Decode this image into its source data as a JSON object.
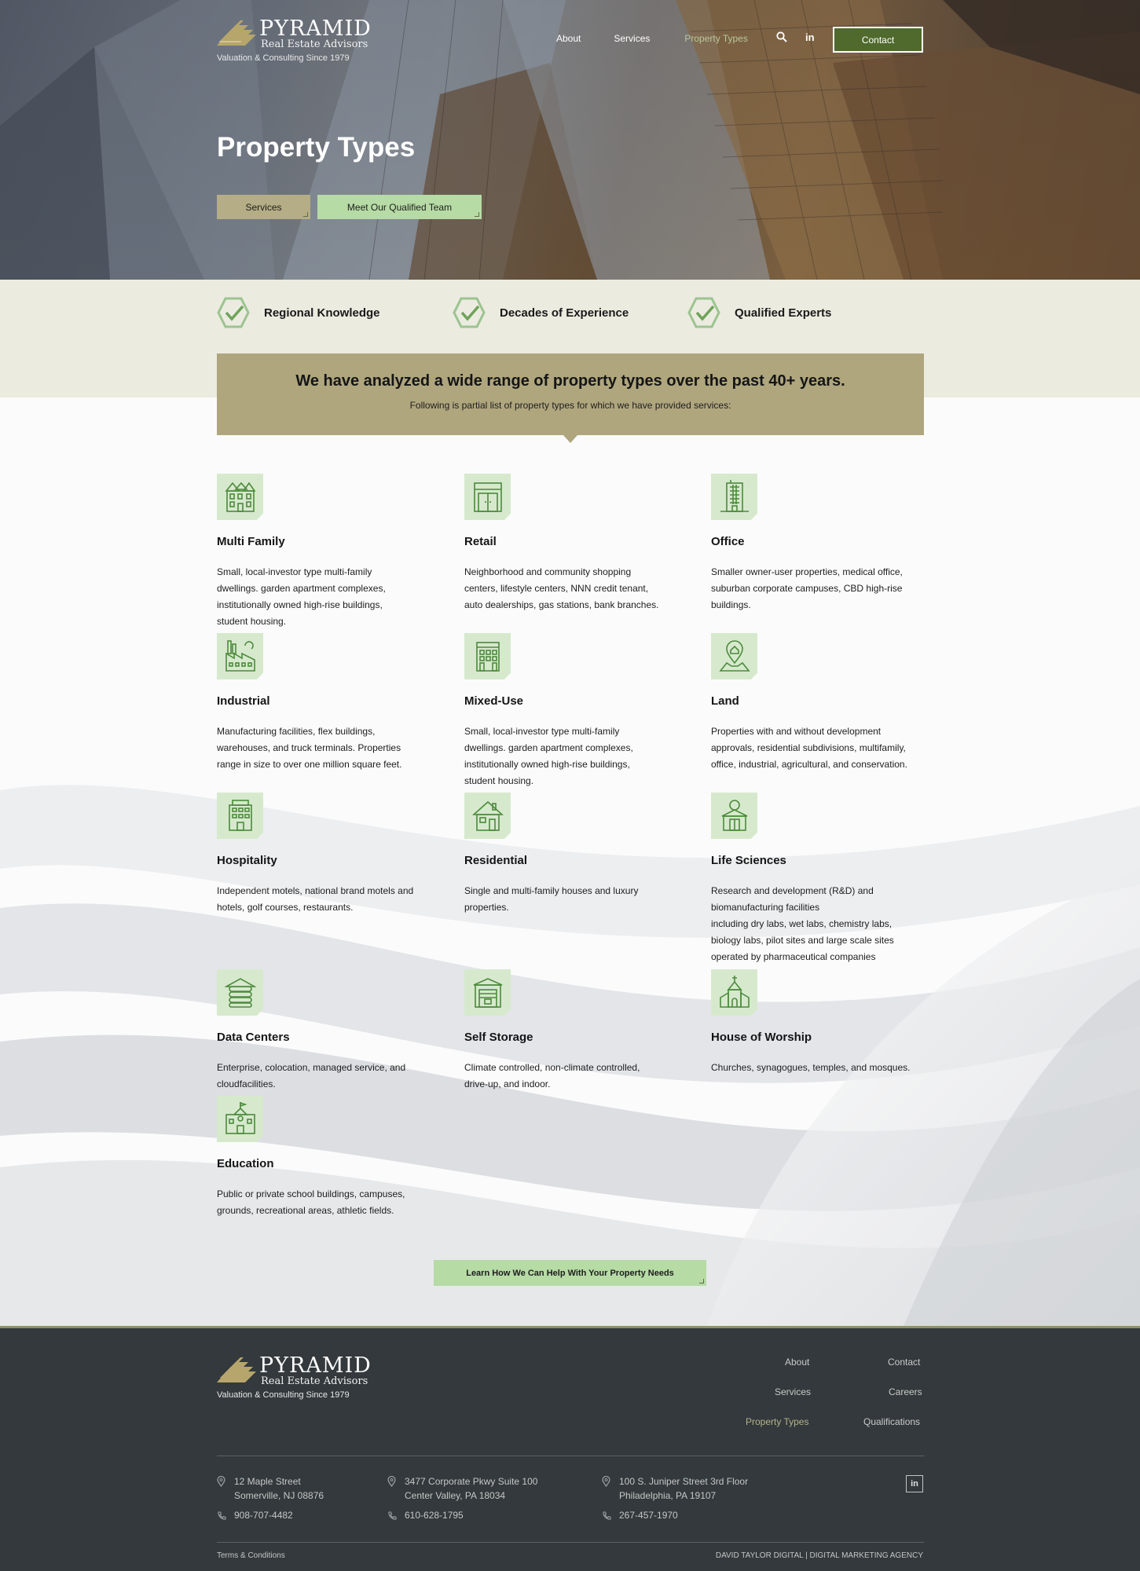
{
  "brand": {
    "name": "PYRAMID",
    "subtitle": "Real Estate Advisors",
    "tagline": "Valuation & Consulting Since 1979"
  },
  "nav": {
    "items": [
      {
        "label": "About",
        "active": false
      },
      {
        "label": "Services",
        "active": false
      },
      {
        "label": "Property Types",
        "active": true
      }
    ],
    "linkedin_label": "in",
    "contact_label": "Contact"
  },
  "hero": {
    "title": "Property Types",
    "services_button": "Services",
    "team_button": "Meet Our Qualified Team"
  },
  "features": [
    {
      "label": "Regional Knowledge"
    },
    {
      "label": "Decades of Experience"
    },
    {
      "label": "Qualified Experts"
    }
  ],
  "intro": {
    "heading": "We have analyzed a wide range of property types over the past 40+ years.",
    "subtext": "Following is partial list of property types for which we have provided services:"
  },
  "property_types": [
    {
      "title": "Multi Family",
      "icon": "apartment-building-icon",
      "description": "Small, local-investor type multi-family\ndwellings. garden apartment complexes,\ninstitutionally owned high-rise buildings,\nstudent housing."
    },
    {
      "title": "Retail",
      "icon": "storefront-icon",
      "description": "Neighborhood and community shopping\ncenters, lifestyle centers, NNN credit tenant,\nauto dealerships, gas stations, bank branches."
    },
    {
      "title": "Office",
      "icon": "office-tower-icon",
      "description": "Smaller owner-user properties, medical office,\nsuburban corporate campuses, CBD high-rise\nbuildings."
    },
    {
      "title": "Industrial",
      "icon": "factory-icon",
      "description": "Manufacturing facilities, flex buildings,\nwarehouses, and truck terminals. Properties\nrange in size to over one million square feet."
    },
    {
      "title": "Mixed-Use",
      "icon": "mixed-use-building-icon",
      "description": "Small, local-investor type multi-family\ndwellings. garden apartment complexes,\ninstitutionally owned high-rise buildings,\nstudent housing."
    },
    {
      "title": "Land",
      "icon": "land-pin-icon",
      "description": "Properties with and without development\napprovals, residential subdivisions, multifamily,\noffice, industrial, agricultural, and conservation."
    },
    {
      "title": "Hospitality",
      "icon": "hotel-icon",
      "description": "Independent motels, national brand motels and\nhotels, golf courses, restaurants."
    },
    {
      "title": "Residential",
      "icon": "house-icon",
      "description": "Single and multi-family houses and luxury\nproperties."
    },
    {
      "title": "Life Sciences",
      "icon": "laboratory-icon",
      "description": "Research and development (R&D) and\nbiomanufacturing facilities\nincluding dry labs, wet labs, chemistry labs,\nbiology labs, pilot sites and large scale sites\noperated by pharmaceutical companies"
    },
    {
      "title": "Data Centers",
      "icon": "database-icon",
      "description": "Enterprise, colocation, managed service, and\ncloudfacilities."
    },
    {
      "title": "Self Storage",
      "icon": "storage-unit-icon",
      "description": "Climate controlled, non-climate controlled,\ndrive-up, and indoor."
    },
    {
      "title": "House of Worship",
      "icon": "church-icon",
      "description": "Churches, synagogues, temples, and mosques."
    },
    {
      "title": "Education",
      "icon": "school-icon",
      "description": "Public or private school buildings, campuses,\ngrounds, recreational areas, athletic fields."
    }
  ],
  "cta": {
    "label": "Learn How We Can Help With Your Property Needs"
  },
  "footer": {
    "links": [
      {
        "label": "About",
        "active": false
      },
      {
        "label": "Contact",
        "active": false
      },
      {
        "label": "Services",
        "active": false
      },
      {
        "label": "Careers",
        "active": false
      },
      {
        "label": "Property Types",
        "active": true
      },
      {
        "label": "Qualifications",
        "active": false
      }
    ],
    "offices": [
      {
        "line1": "12 Maple Street",
        "line2": "Somerville, NJ 08876",
        "phone": "908-707-4482"
      },
      {
        "line1": "3477 Corporate Pkwy Suite 100",
        "line2": "Center Valley, PA 18034",
        "phone": "610-628-1795"
      },
      {
        "line1": "100 S. Juniper Street 3rd Floor",
        "line2": "Philadelphia, PA 19107",
        "phone": "267-457-1970"
      }
    ],
    "linkedin_label": "in",
    "terms": "Terms & Conditions",
    "credit": "DAVID TAYLOR DIGITAL | DIGITAL MARKETING AGENCY"
  },
  "colors": {
    "accent_green": "#b6dba5",
    "accent_khaki": "#afa67e",
    "icon_green": "#4d8a3c",
    "footer_bg": "#33393c",
    "band_bg": "#ebebe0"
  }
}
